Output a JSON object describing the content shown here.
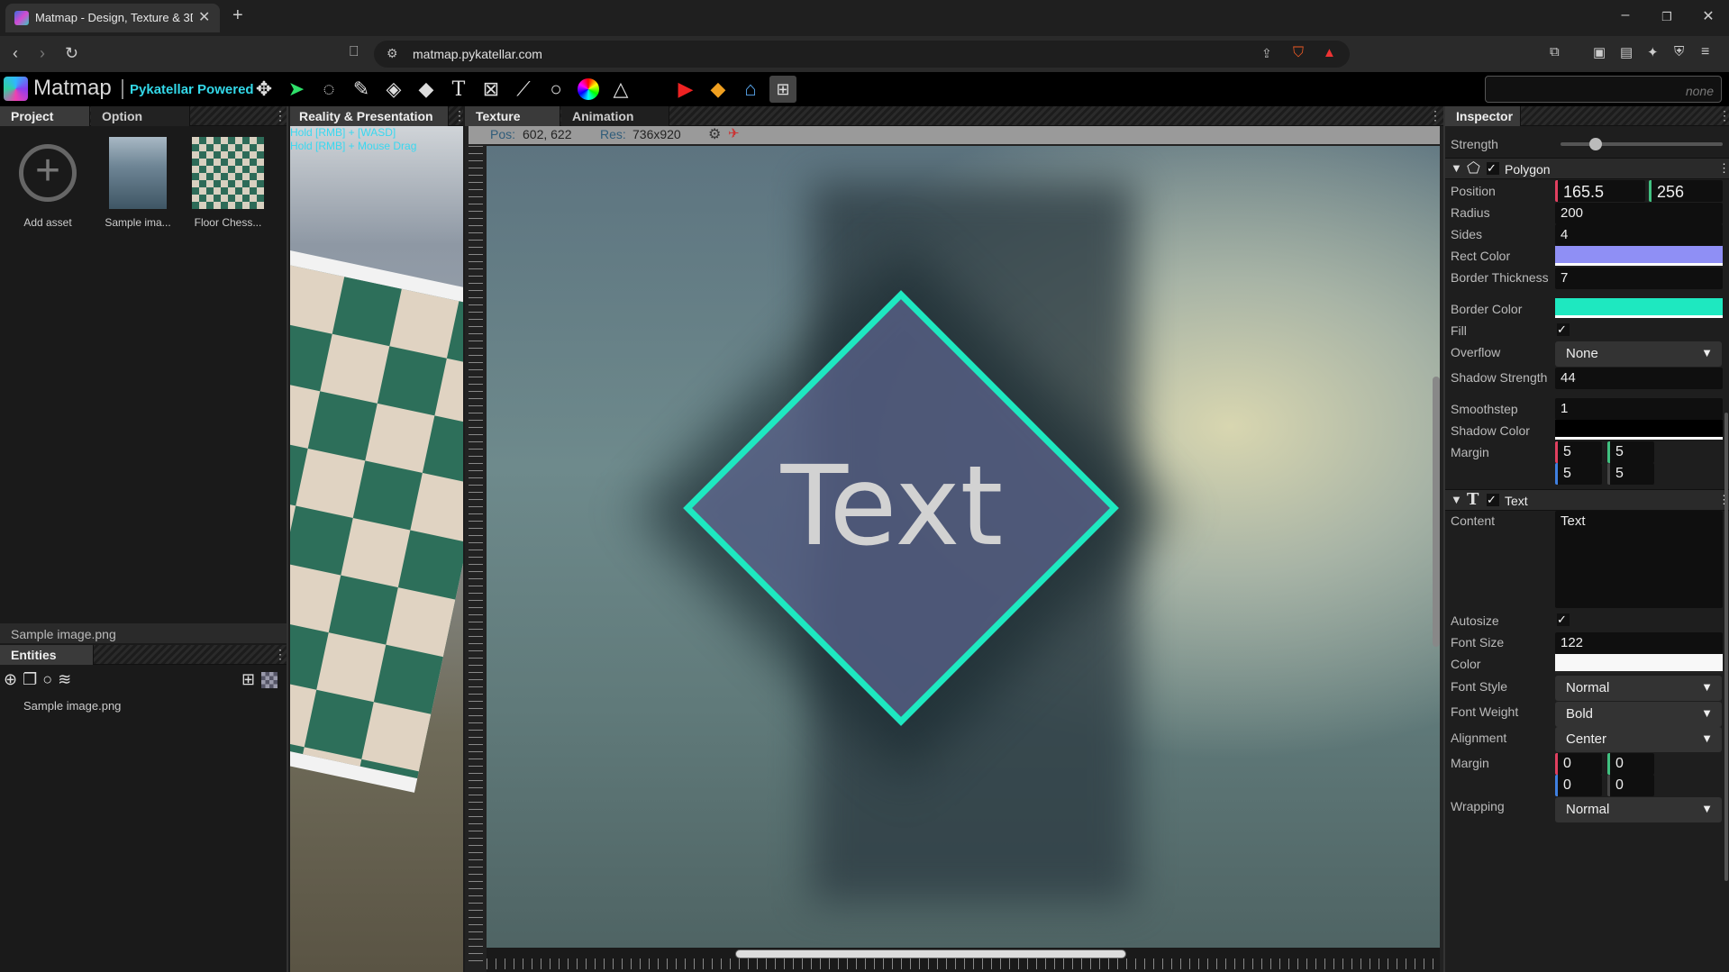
{
  "browser": {
    "tab_title": "Matmap - Design, Texture & 3D",
    "url": "matmap.pykatellar.com"
  },
  "app": {
    "logo_text": "Matmap",
    "powered_text": "Pykatellar Powered",
    "search_placeholder": "none",
    "tools": [
      "move-icon",
      "select-arrow-icon",
      "lasso-icon",
      "pen-icon",
      "fill-bucket-icon",
      "eraser-icon",
      "text-tool-icon",
      "transform-icon",
      "line-icon",
      "ellipse-icon",
      "color-wheel-icon",
      "triangle-icon",
      "youtube-icon",
      "gem-icon",
      "graduation-cap-icon",
      "cart-icon"
    ]
  },
  "left": {
    "tabs": [
      "Project",
      "Option"
    ],
    "assets": [
      "Add asset",
      "Sample ima...",
      "Floor Chess..."
    ],
    "selected_file": "Sample image.png",
    "entities_tab": "Entities",
    "entities": [
      "Sample image.png"
    ]
  },
  "mid": {
    "tab": "Reality & Presentation",
    "hint1": "Hold [RMB] + [WASD]",
    "hint2": "Hold [RMB] + Mouse Drag"
  },
  "texture": {
    "tabs": [
      "Texture",
      "Animation"
    ],
    "pos_label": "Pos:",
    "pos_value": "602, 622",
    "res_label": "Res:",
    "res_value": "736x920",
    "canvas_text": "Text"
  },
  "inspector": {
    "title": "Inspector",
    "strength_label": "Strength",
    "polygon": {
      "title": "Polygon",
      "position_label": "Position",
      "position_x": "165.5",
      "position_y": "256",
      "radius_label": "Radius",
      "radius": "200",
      "sides_label": "Sides",
      "sides": "4",
      "rect_color_label": "Rect Color",
      "rect_color": "#8f8ff5",
      "border_thickness_label": "Border Thickness",
      "border_thickness": "7",
      "border_color_label": "Border Color",
      "border_color": "#1ee8c0",
      "fill_label": "Fill",
      "overflow_label": "Overflow",
      "overflow": "None",
      "shadow_strength_label": "Shadow Strength",
      "shadow_strength": "44",
      "smoothstep_label": "Smoothstep",
      "smoothstep": "1",
      "shadow_color_label": "Shadow Color",
      "margin_label": "Margin",
      "margin": [
        "5",
        "5",
        "5",
        "5"
      ]
    },
    "text": {
      "title": "Text",
      "content_label": "Content",
      "content": "Text",
      "autosize_label": "Autosize",
      "font_size_label": "Font Size",
      "font_size": "122",
      "color_label": "Color",
      "font_style_label": "Font Style",
      "font_style": "Normal",
      "font_weight_label": "Font Weight",
      "font_weight": "Bold",
      "alignment_label": "Alignment",
      "alignment": "Center",
      "margin_label": "Margin",
      "margin": [
        "0",
        "0",
        "0",
        "0"
      ],
      "wrapping_label": "Wrapping",
      "wrapping": "Normal"
    }
  }
}
